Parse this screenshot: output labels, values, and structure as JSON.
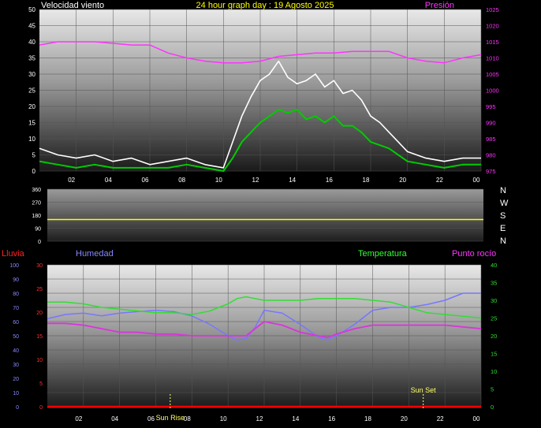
{
  "header": {
    "wind_label": "Velocidad viento",
    "title": "24 hour graph day : 19 Agosto 2025",
    "pressure_label": "Presión"
  },
  "direction": {
    "letters": [
      "N",
      "W",
      "S",
      "E",
      "N"
    ]
  },
  "lower_header": {
    "rain_label": "Lluvia",
    "humidity_label": "Humedad",
    "temperature_label": "Temperatura",
    "dew_label": "Punto rocío"
  },
  "events": {
    "sunrise_label": "Sun Rise",
    "sunset_label": "Sun Set",
    "sunrise_hour": 6.8,
    "sunset_hour": 20.8
  },
  "colors": {
    "wind": "#ffffff",
    "wind_avg": "#00cc00",
    "gust": "#ccffcc",
    "pressure": "#ff33ff",
    "direction": "#ffff00",
    "humidity": "#7777ff",
    "temperature": "#33dd33",
    "dew": "#dd33dd",
    "rain": "#ff0000",
    "events": "#ffff66"
  },
  "chart_data": [
    {
      "type": "line",
      "id": "wind-pressure",
      "x_ticks": [
        "02",
        "04",
        "06",
        "08",
        "10",
        "12",
        "14",
        "16",
        "18",
        "20",
        "22",
        "00"
      ],
      "y_left": {
        "min": 0,
        "max": 50,
        "ticks": [
          0,
          5,
          10,
          15,
          20,
          25,
          30,
          35,
          40,
          45,
          50
        ]
      },
      "y_right": {
        "min": 975,
        "max": 1025,
        "ticks": [
          975,
          980,
          985,
          990,
          995,
          1000,
          1005,
          1010,
          1015,
          1020,
          1025
        ]
      },
      "grid": true,
      "series": [
        {
          "key": "wind_gust",
          "x": [
            0,
            1,
            2,
            3,
            4,
            5,
            6,
            7,
            8,
            9,
            10,
            10.5,
            11,
            11.5,
            12,
            12.5,
            13,
            13.5,
            14,
            14.5,
            15,
            15.5,
            16,
            16.5,
            17,
            17.5,
            18,
            18.5,
            19,
            19.5,
            20,
            21,
            22,
            23,
            24
          ],
          "y": [
            7,
            5,
            4,
            5,
            3,
            4,
            2,
            3,
            4,
            2,
            1,
            9,
            17,
            23,
            28,
            30,
            34,
            29,
            27,
            28,
            30,
            26,
            28,
            24,
            25,
            22,
            17,
            15,
            12,
            9,
            6,
            4,
            3,
            4,
            4
          ]
        },
        {
          "key": "wind_avg",
          "x": [
            0,
            1,
            2,
            3,
            4,
            5,
            6,
            7,
            8,
            9,
            10,
            10.5,
            11,
            11.5,
            12,
            12.5,
            13,
            13.5,
            14,
            14.5,
            15,
            15.5,
            16,
            16.5,
            17,
            17.5,
            18,
            18.5,
            19,
            19.5,
            20,
            21,
            22,
            23,
            24
          ],
          "y": [
            3,
            2,
            1,
            2,
            1,
            1,
            1,
            1,
            2,
            1,
            0,
            4,
            9,
            12,
            15,
            17,
            19,
            18,
            19,
            16,
            17,
            15,
            17,
            14,
            14,
            12,
            9,
            8,
            7,
            5,
            3,
            2,
            1,
            2,
            2
          ]
        },
        {
          "key": "pressure",
          "x": [
            0,
            1,
            2,
            3,
            4,
            5,
            6,
            7,
            8,
            9,
            10,
            11,
            12,
            13,
            14,
            15,
            16,
            17,
            18,
            19,
            20,
            21,
            22,
            23,
            24
          ],
          "y": [
            1014,
            1015,
            1015,
            1015,
            1014.5,
            1014,
            1014,
            1011.5,
            1010,
            1009,
            1008.5,
            1008.5,
            1009,
            1010.5,
            1011,
            1011.5,
            1011.5,
            1012,
            1012,
            1012,
            1010,
            1009,
            1008.5,
            1010,
            1011
          ]
        }
      ]
    },
    {
      "type": "line",
      "id": "wind-direction",
      "y_ticks": [
        0,
        90,
        180,
        270,
        360
      ],
      "ylim": [
        0,
        360
      ],
      "grid": true,
      "series": [
        {
          "key": "direction",
          "x": [
            0,
            24
          ],
          "y": [
            150,
            150
          ]
        }
      ]
    },
    {
      "type": "line",
      "id": "humidity-temp",
      "x_ticks": [
        "02",
        "04",
        "06",
        "08",
        "10",
        "12",
        "14",
        "16",
        "18",
        "20",
        "22",
        "00"
      ],
      "y_rain": {
        "min": 0,
        "max": 30,
        "ticks": [
          0,
          5,
          10,
          15,
          20,
          25,
          30
        ]
      },
      "y_humidity": {
        "min": 0,
        "max": 100,
        "ticks": [
          0,
          10,
          20,
          30,
          40,
          50,
          60,
          70,
          80,
          90,
          100
        ]
      },
      "y_temperature": {
        "min": 0,
        "max": 40,
        "ticks": [
          0,
          5,
          10,
          15,
          20,
          25,
          30,
          35,
          40
        ]
      },
      "grid": true,
      "series": [
        {
          "key": "humidity",
          "x": [
            0,
            1,
            2,
            3,
            4,
            5,
            6,
            7,
            8,
            9,
            10,
            10.5,
            11,
            11.5,
            12,
            13,
            14,
            15,
            15.5,
            16,
            17,
            18,
            19,
            20,
            21,
            22,
            23,
            24
          ],
          "y": [
            62,
            65,
            66,
            64,
            66,
            67,
            68,
            67,
            64,
            58,
            50,
            47,
            48,
            56,
            68,
            66,
            58,
            49,
            47,
            50,
            58,
            68,
            70,
            70,
            72,
            75,
            80,
            80
          ]
        },
        {
          "key": "temperature",
          "x": [
            0,
            1,
            2,
            3,
            4,
            5,
            6,
            7,
            8,
            9,
            10,
            10.5,
            11,
            11.5,
            12,
            13,
            14,
            15,
            16,
            17,
            18,
            19,
            20,
            21,
            22,
            23,
            24
          ],
          "y": [
            29.5,
            29.5,
            29,
            28,
            27.5,
            27,
            26.5,
            26.5,
            26,
            27,
            29,
            30.5,
            31,
            30.5,
            30,
            30,
            30,
            30.5,
            30.5,
            30.5,
            30,
            29.5,
            28,
            26.5,
            26,
            25.5,
            25
          ]
        },
        {
          "key": "dew",
          "x": [
            0,
            1,
            2,
            3,
            4,
            5,
            6,
            7,
            8,
            9,
            10,
            11,
            11.5,
            12,
            13,
            14,
            15,
            15.5,
            16,
            17,
            18,
            19,
            20,
            21,
            22,
            23,
            24
          ],
          "y": [
            23.5,
            23.5,
            23,
            22,
            21,
            21,
            20.5,
            20.5,
            20,
            20,
            20,
            20,
            22,
            24,
            23,
            21,
            20,
            19.5,
            20.5,
            22,
            23,
            23,
            23,
            23,
            23,
            22.5,
            22
          ]
        },
        {
          "key": "rain",
          "x": [
            0,
            24
          ],
          "y": [
            0,
            0
          ]
        }
      ]
    }
  ]
}
